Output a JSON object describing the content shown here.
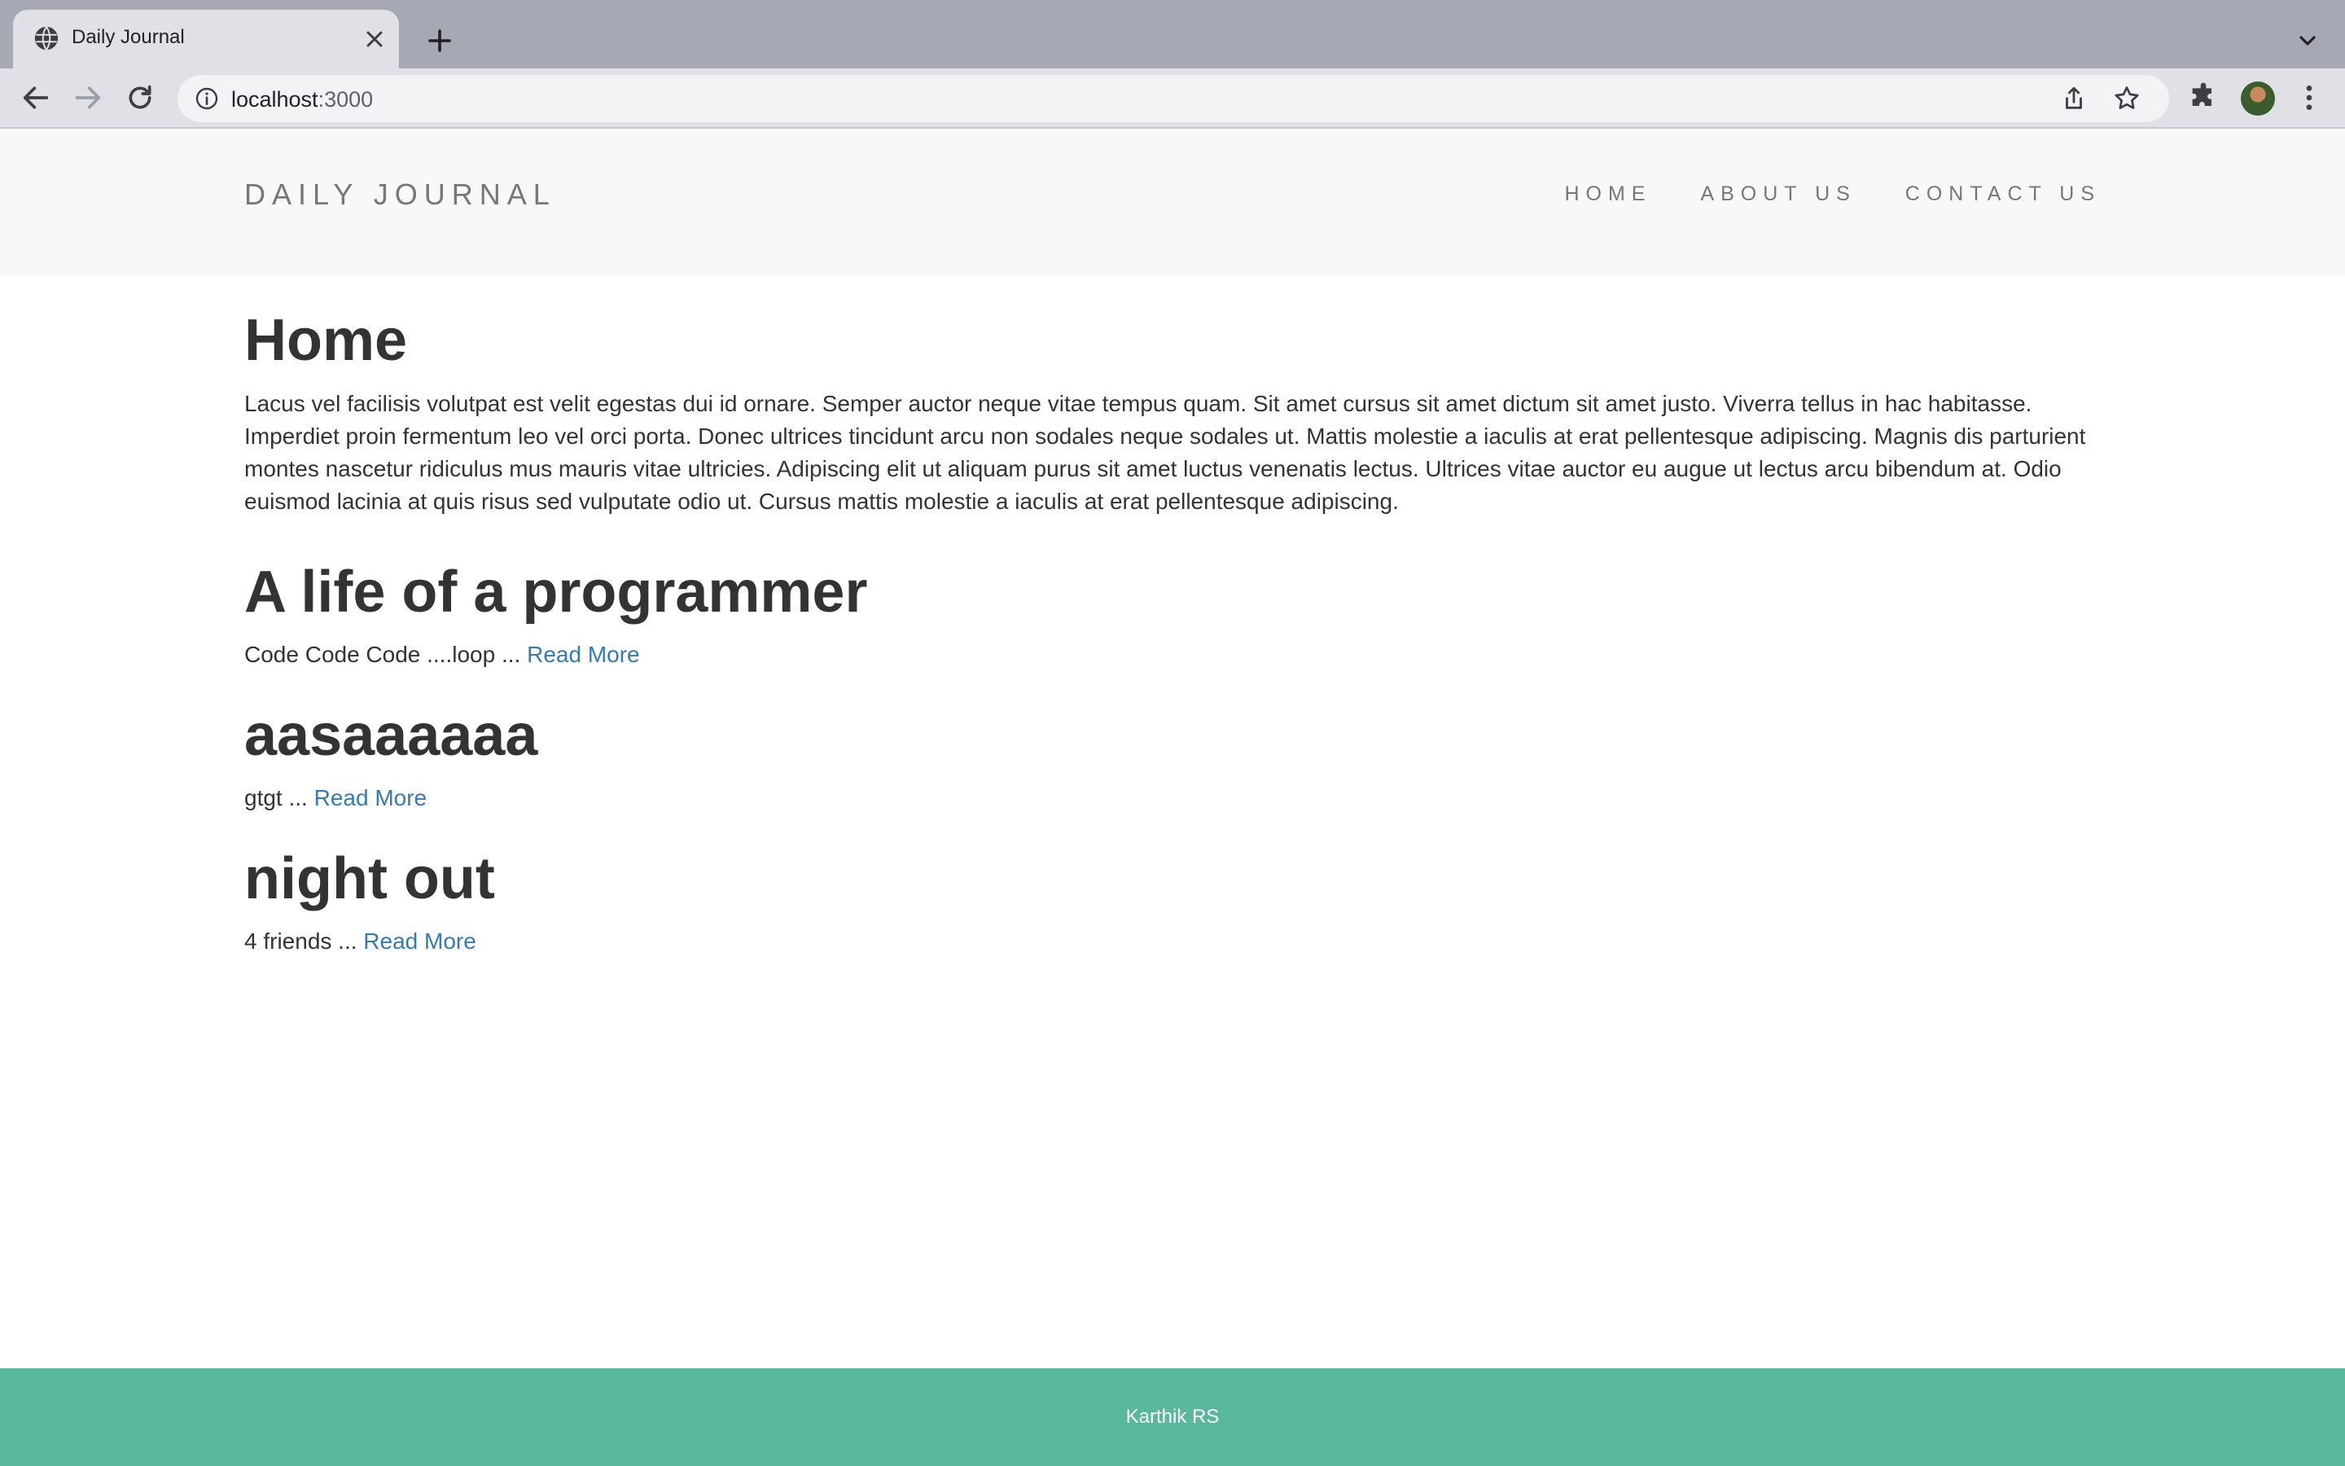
{
  "browser": {
    "tab_title": "Daily Journal",
    "url_host": "localhost",
    "url_port": ":3000"
  },
  "site": {
    "brand": "DAILY JOURNAL",
    "nav": [
      {
        "label": "HOME"
      },
      {
        "label": "ABOUT US"
      },
      {
        "label": "CONTACT US"
      }
    ]
  },
  "home": {
    "title": "Home",
    "intro": "Lacus vel facilisis volutpat est velit egestas dui id ornare. Semper auctor neque vitae tempus quam. Sit amet cursus sit amet dictum sit amet justo. Viverra tellus in hac habitasse. Imperdiet proin fermentum leo vel orci porta. Donec ultrices tincidunt arcu non sodales neque sodales ut. Mattis molestie a iaculis at erat pellentesque adipiscing. Magnis dis parturient montes nascetur ridiculus mus mauris vitae ultricies. Adipiscing elit ut aliquam purus sit amet luctus venenatis lectus. Ultrices vitae auctor eu augue ut lectus arcu bibendum at. Odio euismod lacinia at quis risus sed vulputate odio ut. Cursus mattis molestie a iaculis at erat pellentesque adipiscing."
  },
  "posts": [
    {
      "title": "A life of a programmer",
      "excerpt": "Code Code Code ....loop ... ",
      "link": "Read More"
    },
    {
      "title": "aasaaaaaa",
      "excerpt": "gtgt ... ",
      "link": "Read More"
    },
    {
      "title": "night out",
      "excerpt": "4 friends ... ",
      "link": "Read More"
    }
  ],
  "footer": {
    "text": "Karthik RS"
  },
  "colors": {
    "footer_bg": "#57b89b",
    "link": "#337ab7",
    "header_bg": "#f8f8f8"
  }
}
